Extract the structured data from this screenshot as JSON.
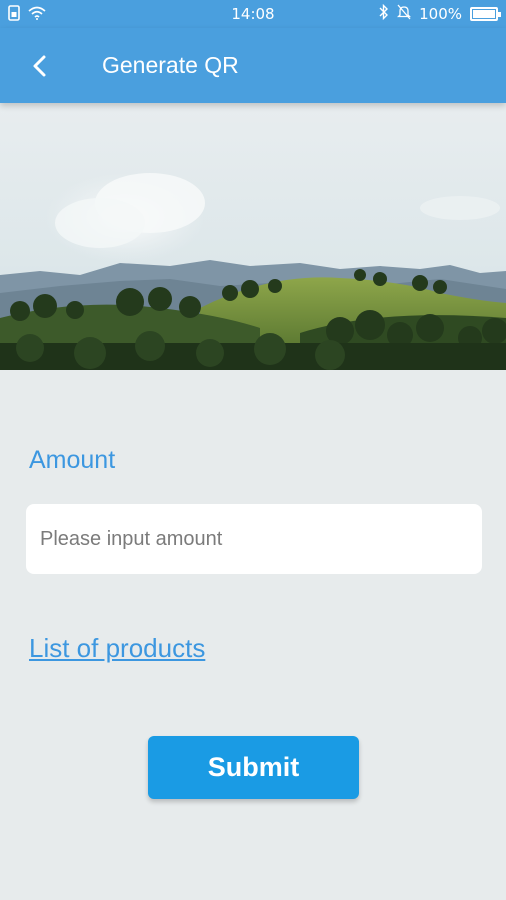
{
  "status_bar": {
    "time": "14:08",
    "battery_percent": "100%",
    "battery_level": 1.0,
    "icons_left": [
      "sim-icon",
      "wifi-icon"
    ],
    "icons_right": [
      "bluetooth-icon",
      "mute-bell-icon",
      "battery-icon"
    ]
  },
  "app_bar": {
    "title": "Generate QR",
    "back_icon": "chevron-left-icon"
  },
  "form": {
    "amount_label": "Amount",
    "amount_value": "",
    "amount_placeholder": "Please input amount",
    "products_link": "List of products",
    "submit_label": "Submit"
  },
  "colors": {
    "primary": "#4a9fde",
    "accent_text": "#3c97e0",
    "button": "#1a9be4",
    "background": "#e7ebec"
  }
}
